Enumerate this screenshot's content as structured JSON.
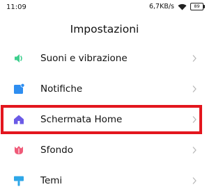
{
  "status_bar": {
    "time": "11:09",
    "network_speed": "6,7KB/s",
    "battery_level": "89"
  },
  "header": {
    "title": "Impostazioni"
  },
  "settings": {
    "items": [
      {
        "label": "Suoni e vibrazione",
        "icon": "speaker-icon",
        "color": "#3ecf8e"
      },
      {
        "label": "Notifiche",
        "icon": "notification-icon",
        "color": "#2e8ef0"
      },
      {
        "label": "Schermata Home",
        "icon": "home-icon",
        "color": "#6b5be6"
      },
      {
        "label": "Sfondo",
        "icon": "tulip-icon",
        "color": "#ef5a78"
      },
      {
        "label": "Temi",
        "icon": "paint-roller-icon",
        "color": "#2ea7e8"
      }
    ]
  },
  "highlight": {
    "color": "#e3161e",
    "target": "Schermata Home"
  }
}
